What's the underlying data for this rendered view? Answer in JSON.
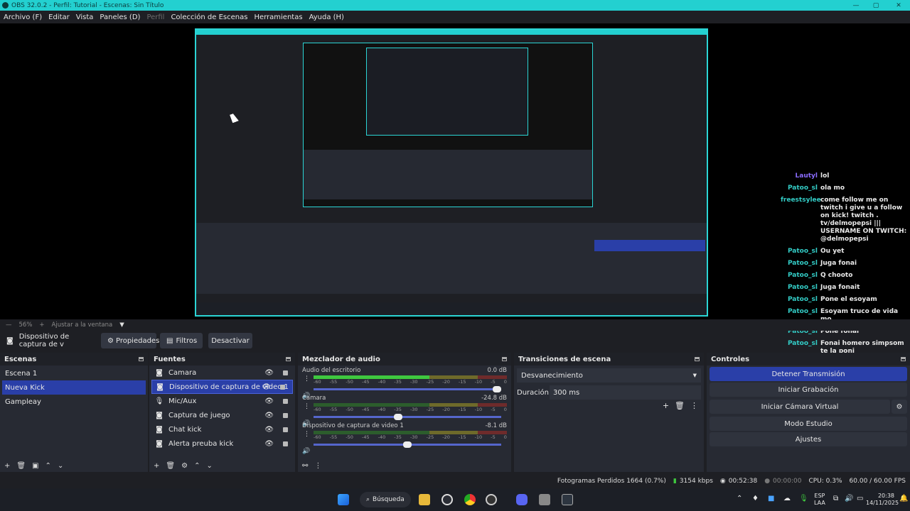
{
  "window": {
    "title": "OBS 32.0.2 - Perfil: Tutorial - Escenas: Sin Título",
    "controls": [
      "—",
      "▢",
      "✕"
    ]
  },
  "menu": [
    "Archivo (F)",
    "Editar",
    "Vista",
    "Paneles (D)",
    "Perfil",
    "Colección de Escenas",
    "Herramientas",
    "Ayuda (H)"
  ],
  "preview_bar": {
    "zoom": "56%",
    "fit": "Ajustar a la ventana"
  },
  "source_toolbar": {
    "source": "Dispositivo de captura de v",
    "properties": "Propiedades",
    "filters": "Filtros",
    "deactivate": "Desactivar"
  },
  "scenes": {
    "title": "Escenas",
    "items": [
      "Escena 1",
      "Nueva Kick",
      "Gampleay"
    ],
    "selected": 1
  },
  "sources": {
    "title": "Fuentes",
    "items": [
      {
        "label": "Camara",
        "icon": "camera-icon"
      },
      {
        "label": "Dispositivo de captura de video 1",
        "icon": "camera-icon"
      },
      {
        "label": "Mic/Aux",
        "icon": "mic-icon"
      },
      {
        "label": "Captura de juego",
        "icon": "camera-icon"
      },
      {
        "label": "Chat kick",
        "icon": "camera-icon"
      },
      {
        "label": "Alerta preuba kick",
        "icon": "camera-icon"
      }
    ],
    "selected": 1
  },
  "mixer": {
    "title": "Mezclador de audio",
    "ticks": [
      "-60",
      "-55",
      "-50",
      "-45",
      "-40",
      "-35",
      "-30",
      "-25",
      "-20",
      "-15",
      "-10",
      "-5",
      "0"
    ],
    "channels": [
      {
        "name": "Audio del escritorio",
        "db": "0.0 dB",
        "level": 0.6,
        "fader": 1.0
      },
      {
        "name": "Camara",
        "db": "-24.8 dB",
        "level": 0.0,
        "fader": 0.45
      },
      {
        "name": "Dispositivo de captura de video 1",
        "db": "-8.1 dB",
        "level": 0.0,
        "fader": 0.5
      }
    ]
  },
  "transitions": {
    "title": "Transiciones de escena",
    "type": "Desvanecimiento",
    "duration_label": "Duración",
    "duration": "300 ms"
  },
  "controls": {
    "title": "Controles",
    "buttons": [
      "Detener Transmisión",
      "Iniciar Grabación",
      "Iniciar Cámara Virtual",
      "Modo Estudio",
      "Ajustes"
    ]
  },
  "status": {
    "dropped": "Fotogramas Perdidos 1664 (0.7%)",
    "bitrate": "3154 kbps",
    "stream_time": "00:52:38",
    "rec_time": "00:00:00",
    "cpu": "CPU: 0.3%",
    "fps": "60.00 / 60.00 FPS"
  },
  "taskbar": {
    "search": "Búsqueda",
    "lang1": "ESP",
    "lang2": "LAA",
    "time": "20:38",
    "date": "14/11/2025"
  },
  "chat": [
    {
      "name": "Lautyl",
      "msg": "lol",
      "color": "#8a6cff"
    },
    {
      "name": "Patoo_sl",
      "msg": "ola mo"
    },
    {
      "name": "freestsylee",
      "msg": "come follow me on twitch i give u a follow on kick! twitch . tv/delmopepsi ||| USERNAME ON TWITCH: @delmopepsi"
    },
    {
      "name": "Patoo_sl",
      "msg": "Ou yet"
    },
    {
      "name": "Patoo_sl",
      "msg": "Juga fonai"
    },
    {
      "name": "Patoo_sl",
      "msg": "Q chooto"
    },
    {
      "name": "Patoo_sl",
      "msg": "Juga fonait"
    },
    {
      "name": "Patoo_sl",
      "msg": "Pone el esoyam"
    },
    {
      "name": "Patoo_sl",
      "msg": "Esoyam truco de vida mo"
    },
    {
      "name": "Patoo_sl",
      "msg": "Pone fonai"
    },
    {
      "name": "Patoo_sl",
      "msg": "Fonai homero simpsom te la poni"
    }
  ]
}
